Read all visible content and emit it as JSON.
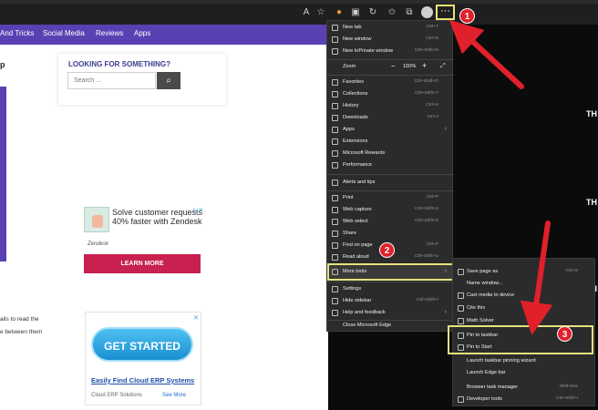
{
  "site_nav": {
    "links": [
      "And Tricks",
      "Social Media",
      "Reviews",
      "Apps"
    ]
  },
  "page": {
    "left_top_fragment": "p",
    "search_heading": "LOOKING FOR SOMETHING?",
    "search_placeholder": "Search ...",
    "ad_text": "Solve customer requests 40% faster with Zendesk",
    "ad_brand": "Zendesk",
    "learn_more": "LEARN MORE",
    "para_fragment_1": "ails to read the",
    "para_fragment_2": "e between them",
    "get_started": "GET STARTED",
    "cloud_link": "Easily Find Cloud ERP Systems",
    "cloud_source": "Cloud ERP Solutions",
    "cloud_more": "See More",
    "right_fragments": [
      "TH",
      "TH",
      "TH"
    ]
  },
  "browser_menu": {
    "items": [
      {
        "label": "New tab",
        "shortcut": "Ctrl+T"
      },
      {
        "label": "New window",
        "shortcut": "Ctrl+N"
      },
      {
        "label": "New InPrivate window",
        "shortcut": "Ctrl+Shift+N"
      },
      {
        "label": "Zoom",
        "value": "100%"
      },
      {
        "label": "Favorites",
        "shortcut": "Ctrl+Shift+O"
      },
      {
        "label": "Collections",
        "shortcut": "Ctrl+Shift+Y"
      },
      {
        "label": "History",
        "shortcut": "Ctrl+H"
      },
      {
        "label": "Downloads",
        "shortcut": "Ctrl+J"
      },
      {
        "label": "Apps"
      },
      {
        "label": "Extensions"
      },
      {
        "label": "Microsoft Rewards"
      },
      {
        "label": "Performance"
      },
      {
        "label": "Alerts and tips"
      },
      {
        "label": "Print",
        "shortcut": "Ctrl+P"
      },
      {
        "label": "Web capture",
        "shortcut": "Ctrl+Shift+S"
      },
      {
        "label": "Web select",
        "shortcut": "Ctrl+Shift+X"
      },
      {
        "label": "Share"
      },
      {
        "label": "Find on page",
        "shortcut": "Ctrl+F"
      },
      {
        "label": "Read aloud",
        "shortcut": "Ctrl+Shift+U"
      },
      {
        "label": "More tools"
      },
      {
        "label": "Settings"
      },
      {
        "label": "Hide sidebar",
        "shortcut": "Ctrl+Shift+/"
      },
      {
        "label": "Help and feedback"
      },
      {
        "label": "Close Microsoft Edge"
      }
    ],
    "zoom_minus": "−",
    "zoom_plus": "+"
  },
  "more_tools_menu": {
    "items": [
      {
        "label": "Save page as",
        "shortcut": "Ctrl+S"
      },
      {
        "label": "Name window..."
      },
      {
        "label": "Cast media to device"
      },
      {
        "label": "Cite this"
      },
      {
        "label": "Math Solver"
      },
      {
        "label": "Pin to taskbar"
      },
      {
        "label": "Pin to Start"
      },
      {
        "label": "Launch taskbar pinning wizard"
      },
      {
        "label": "Launch Edge bar"
      },
      {
        "label": "Browser task manager",
        "shortcut": "Shift+Esc"
      },
      {
        "label": "Developer tools",
        "shortcut": "Ctrl+Shift+I"
      }
    ]
  },
  "annotations": {
    "badges": [
      "1",
      "2",
      "3"
    ],
    "arrow_color": "#e0202a",
    "highlight_color": "#e8e27a"
  },
  "toolbar": {
    "more_label": "···"
  }
}
